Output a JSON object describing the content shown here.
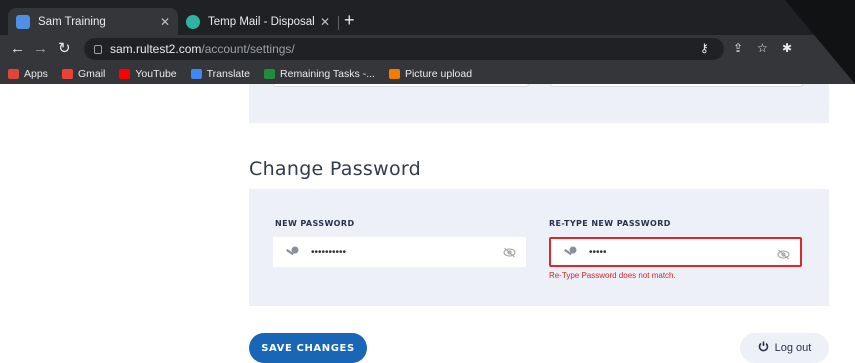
{
  "browser": {
    "tabs": [
      {
        "title": "Sam Training",
        "favicon_color": "#4f8fe6"
      },
      {
        "title": "Temp Mail - Disposable Tempo",
        "favicon_color": "#2fb3a3"
      }
    ],
    "url_host": "sam.rultest2.com",
    "url_path": "/account/settings/",
    "bookmarks": [
      {
        "label": "Apps",
        "color": "#e0453a"
      },
      {
        "label": "Gmail",
        "color": "#ea4335"
      },
      {
        "label": "YouTube",
        "color": "#ff0000"
      },
      {
        "label": "Translate",
        "color": "#4285f4"
      },
      {
        "label": "Remaining Tasks -...",
        "color": "#1e8e3e"
      },
      {
        "label": "Picture upload",
        "color": "#f57c00"
      }
    ]
  },
  "page": {
    "section_title": "Change Password",
    "new_password": {
      "label": "NEW PASSWORD",
      "value_masked": "••••••••••"
    },
    "retype_password": {
      "label": "RE-TYPE NEW PASSWORD",
      "value_masked": "•••••",
      "error": "Re-Type Password does not match."
    },
    "save_label": "SAVE CHANGES",
    "logout_label": "Log out"
  },
  "colors": {
    "accent": "#1966b6",
    "error": "#e0262b",
    "panel_bg": "#eef0f8"
  }
}
